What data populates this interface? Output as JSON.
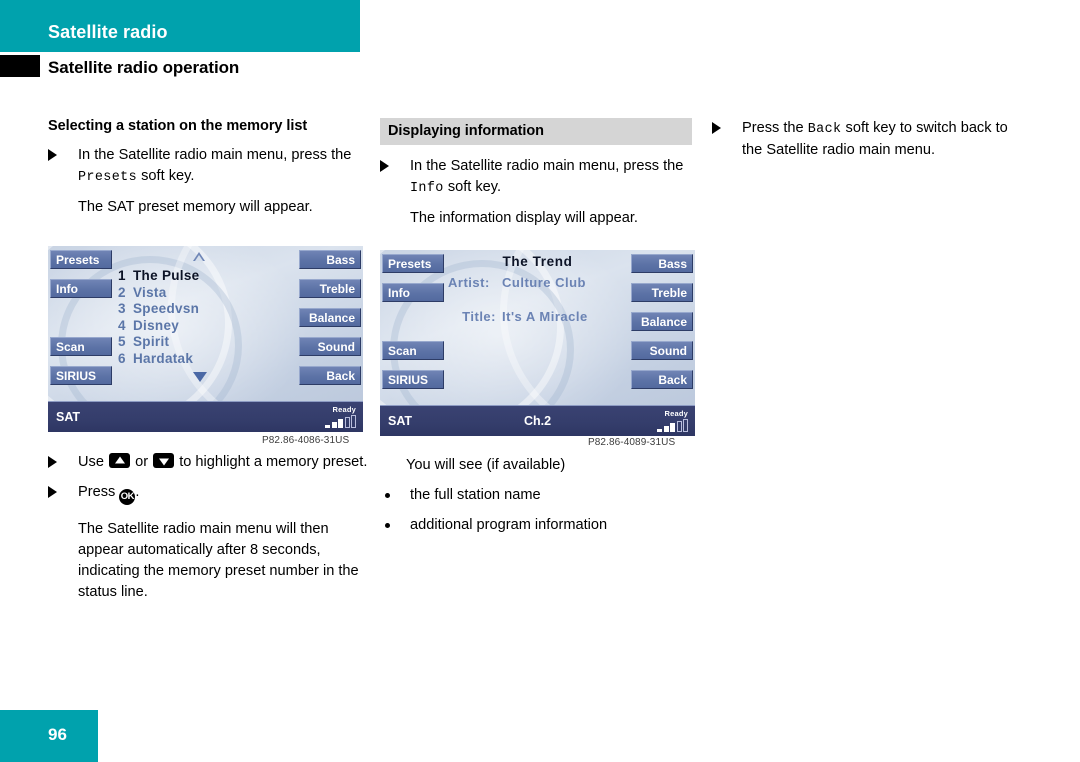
{
  "header": {
    "band_title": "Satellite radio",
    "subtitle": "Satellite radio operation"
  },
  "column1": {
    "heading": "Selecting a station on the memory list",
    "step1_a": "In the Satellite radio main menu, press",
    "step1_b": "the",
    "step1_mono": "Presets",
    "step1_c": "soft key.",
    "result1": "The SAT preset memory will appear.",
    "step2_a": "Use",
    "step2_b": "or",
    "step2_c": "to highlight a memory",
    "step2_d": "preset.",
    "step3_a": "Press",
    "step3_ok": "OK",
    "step3_b": ".",
    "result2": "The Satellite radio main menu will then appear automatically after 8 seconds, indicating the memory preset number in the status line.",
    "caption": "P82.86-4086-31US"
  },
  "column2": {
    "heading": "Displaying information",
    "step1_a": "In the Satellite radio main menu, press",
    "step1_b": "the",
    "step1_mono": "Info",
    "step1_c": "soft key.",
    "result1": "The information display will appear.",
    "intro": "You will see (if available)",
    "bullets": [
      "the full station name",
      "additional program information"
    ],
    "caption": "P82.86-4089-31US"
  },
  "column3": {
    "step1_a": "Press the",
    "step1_mono": "Back",
    "step1_b": "soft key to switch back",
    "step1_c": "to the Satellite radio main menu."
  },
  "display1": {
    "left_keys": [
      "Presets",
      "Info",
      "Scan",
      "SIRIUS"
    ],
    "right_keys": [
      "Bass",
      "Treble",
      "Balance",
      "Sound",
      "Back"
    ],
    "presets": [
      {
        "num": "1",
        "name": "The Pulse",
        "selected": true
      },
      {
        "num": "2",
        "name": "Vista",
        "selected": false
      },
      {
        "num": "3",
        "name": "Speedvsn",
        "selected": false
      },
      {
        "num": "4",
        "name": "Disney",
        "selected": false
      },
      {
        "num": "5",
        "name": "Spirit",
        "selected": false
      },
      {
        "num": "6",
        "name": "Hardatak",
        "selected": false
      }
    ],
    "status": {
      "source": "SAT",
      "channel": "",
      "signal_label": "Ready",
      "bars_filled": 3,
      "bars_total": 5
    }
  },
  "display2": {
    "left_keys": [
      "Presets",
      "Info",
      "Scan",
      "SIRIUS"
    ],
    "right_keys": [
      "Bass",
      "Treble",
      "Balance",
      "Sound",
      "Back"
    ],
    "station": "The Trend",
    "artist_label": "Artist:",
    "artist_value": "Culture Club",
    "title_label": "Title:",
    "title_value": "It's A Miracle",
    "status": {
      "source": "SAT",
      "channel": "Ch.2",
      "signal_label": "Ready",
      "bars_filled": 3,
      "bars_total": 5
    }
  },
  "footer": {
    "page_number": "96"
  },
  "colors": {
    "brand_teal": "#00a2ad",
    "softkey_blue": "#5c72a6",
    "statusbar_navy": "#343d6b",
    "heading_gray": "#d5d5d5"
  }
}
